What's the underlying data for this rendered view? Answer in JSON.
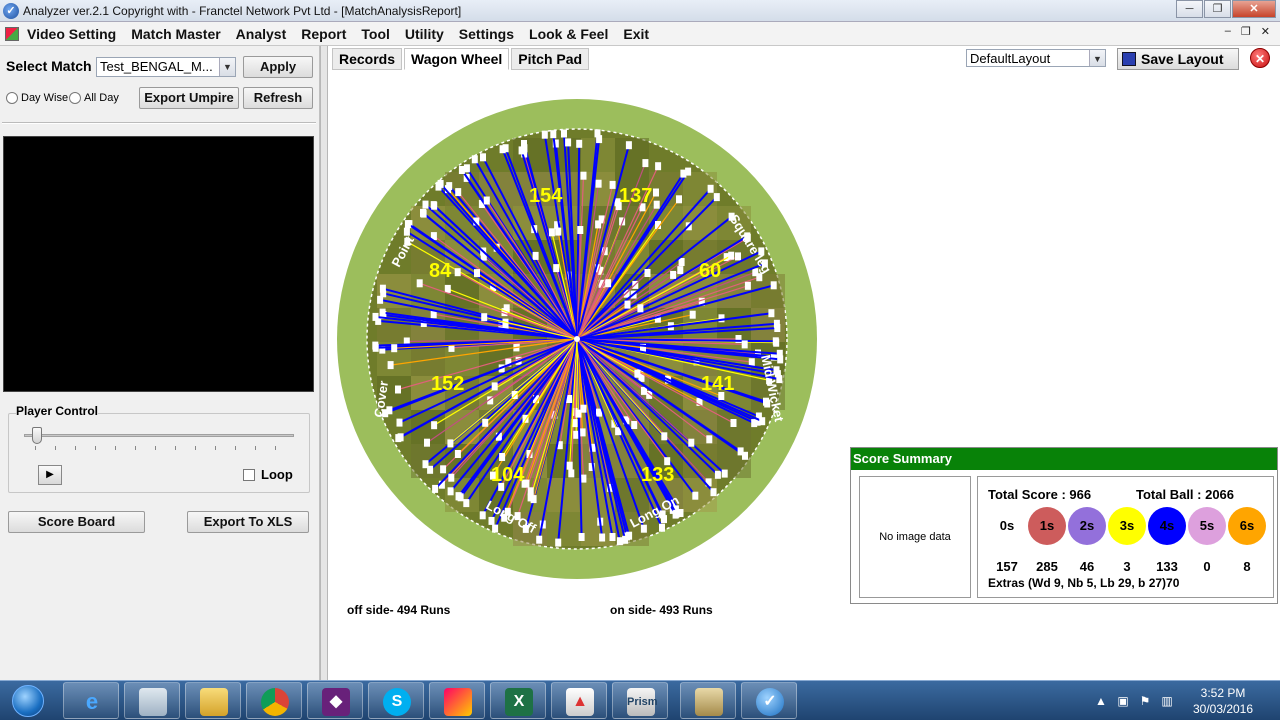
{
  "window": {
    "title": "Analyzer ver.2.1 Copyright with - Franctel Network Pvt Ltd - [MatchAnalysisReport]"
  },
  "menu": [
    "Video Setting",
    "Match Master",
    "Analyst",
    "Report",
    "Tool",
    "Utility",
    "Settings",
    "Look & Feel",
    "Exit"
  ],
  "left": {
    "select_match_label": "Select Match",
    "match_value": "Test_BENGAL_M...",
    "apply": "Apply",
    "day_wise": "Day Wise",
    "all_day": "All Day",
    "export_umpire": "Export Umpire",
    "refresh": "Refresh",
    "player_control": "Player Control",
    "loop": "Loop",
    "score_board": "Score Board",
    "export_xls": "Export To XLS"
  },
  "tabs": [
    "Records",
    "Wagon Wheel",
    "Pitch Pad"
  ],
  "layout": {
    "value": "DefaultLayout",
    "save": "Save Layout"
  },
  "wheel": {
    "zones": [
      "154",
      "137",
      "60",
      "141",
      "133",
      "104",
      "152",
      "84"
    ],
    "field_labels": [
      "Point",
      "Square leg",
      "Mid Wicket",
      "Long On",
      "Long Off",
      "Cover"
    ],
    "off_side": "off side- 494 Runs",
    "on_side": "on side- 493 Runs"
  },
  "summary": {
    "title": "Score Summary",
    "no_image": "No image data",
    "total_score": "Total Score :  966",
    "total_ball": "Total Ball :  2066",
    "circles": [
      {
        "label": "0s",
        "count": "157",
        "color": "#ffffff"
      },
      {
        "label": "1s",
        "count": "285",
        "color": "#cd5c5c"
      },
      {
        "label": "2s",
        "count": "46",
        "color": "#9370db"
      },
      {
        "label": "3s",
        "count": "3",
        "color": "#ffff00"
      },
      {
        "label": "4s",
        "count": "133",
        "color": "#0000ff"
      },
      {
        "label": "5s",
        "count": "0",
        "color": "#dda0dd"
      },
      {
        "label": "6s",
        "count": "8",
        "color": "#ffa500"
      }
    ],
    "extras": "Extras (Wd 9, Nb 5, Lb 29, b 27)70"
  },
  "clock": {
    "time": "3:52 PM",
    "date": "30/03/2016"
  }
}
